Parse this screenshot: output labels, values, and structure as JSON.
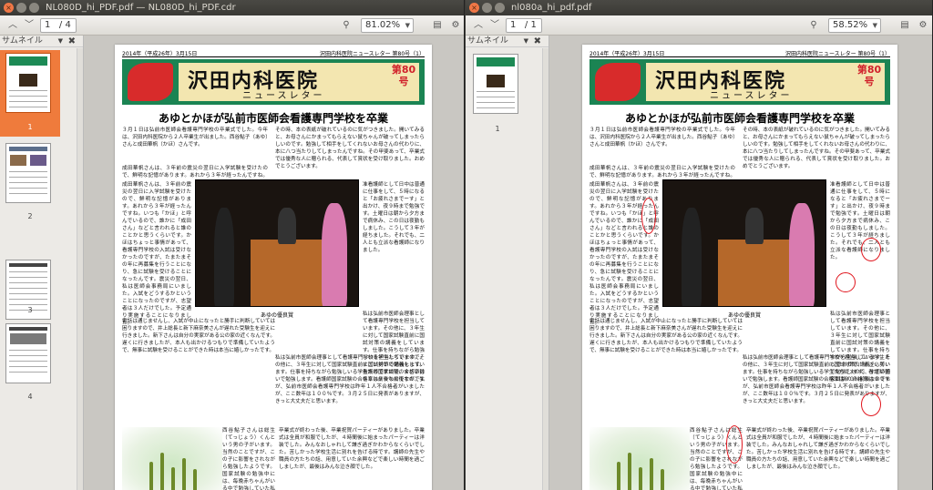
{
  "left_window": {
    "title": "NL080D_hi_PDF.pdf — NL080D_hi_PDF.cdr",
    "page_current": "1",
    "page_total": "/ 4",
    "zoom": "81.02%",
    "sidebar_title": "サムネイル",
    "thumbnails": [
      "1",
      "2",
      "3",
      "4"
    ],
    "selected_thumbnail": "1"
  },
  "right_window": {
    "title": "nl080a_hi_pdf.pdf",
    "page_current": "1",
    "page_total": "/ 1",
    "zoom": "58.52%",
    "sidebar_title": "サムネイル",
    "thumbnails": [
      "1"
    ]
  },
  "newsletter": {
    "date_line": "2014年（平成26年）3月15日",
    "masthead_right": "沢田内科医院ニュースレター 第80号（1）",
    "title": "沢田内科医院",
    "subtitle": "ニュースレター",
    "issue_label": "第80号",
    "headline": "あゆとかほが弘前市医師会看護専門学校を卒業",
    "para1": "３月１日は弘前市医師会看護専門学校の卒業式でした。今年は、沢田内科医院から２人卒業生が出ました。西谷鮎子（あゆ）さんと成田華帆（かほ）さんです。",
    "para2": "成田華帆さんは、３年前の震災の翌日に入学試験を受けたので、鮮明な記憶があります。あれから３年が経ったんですね。いつも「かほ」と呼んでいるので、誰かに「成田さん」などと言われると誰のことかと思うくらいです。かほはちょっと事情があって、看護専門学校の入試は受けなかったのですが、たまたまその年に再募集を行うことになり、急に試験を受けることになったんです。震災の翌日、私は医師会事務局にいました。入試をどうするかということになったのですが、志望者は３人だけでした。予定通り実施することになりました。",
    "para3": "その時、本の表紙が破れているのに気がつきました。開いてみると、お母さんにかまってもらえない鼠ちゃんが破ってしまったらしいのです。勉強して相手をしてくれないお母さんの代わりに、本に八つ当たりしてしまったんですね。その甲斐あって、卒業式では優秀な人に贈られる、代表して賞状を受け取りました。おめでとうございます。",
    "para4": "准看護師として日中は普通に仕事をして、５時になると「お疲れさまでーす」と出かけ、夜９時まで勉強です。土曜日は朝から夕方まで病休み、この日は夜勤もしました。こうして３年が経ちました。それでも、二人とも立派な看護師になりました。",
    "para5": "私は弘前市医師会理事として看護専門学校を担当しています。その他に、３年生に対して国家試験直前に国試対策の講義をしています。仕事を持ちながら勉強しいる学生たちですので、すごい勢いで勉強します。看護師国家試験の合格率は９０％前後なのですが、弘前市医師会看護専門学校は昨年１人不合格者がいましたが、ここ数年は１００％です。３月２５日に発表がありますが、きっと大丈夫だと思います。",
    "para6": "電話は通じませんし、入試が中止になったと勝手に判断していては困りますので、井上総長と新下麻奈美さんが遅れた受験生を迎えに行きました。新下さんは自分の実家がある公の家の近くなんです。遅くに行きましたが、本人も出かけるつもりで準備していたようで、無事に試験を受けることができた時は本当に嬉しかったです。",
    "para7": "西谷鮎子さんは総生（てっじょう）くんという男の子がいます。当然のことですが、この子に影響をされながら勉強したようです。国家試験の勉強中には、毎晩赤ちゃんがいる中で勉強していた私も思いました。",
    "para8": "卒業式が終わった後、卒業祝賀パーティーがありました。卒業式は全員が和服でしたが、４時間後に始まったパーティーは洋装でした。みんなおしゃれして謙ぎ過ぎかわからなくらいでした。苦しかった学校生活に別れを告げる時です。講師の先生や職員の方たちの話、用意していた余興などで楽しい時間を過ごしましたが、最後はみんな泣き顔でした。",
    "photo_caption": "あゆの優良賞"
  }
}
